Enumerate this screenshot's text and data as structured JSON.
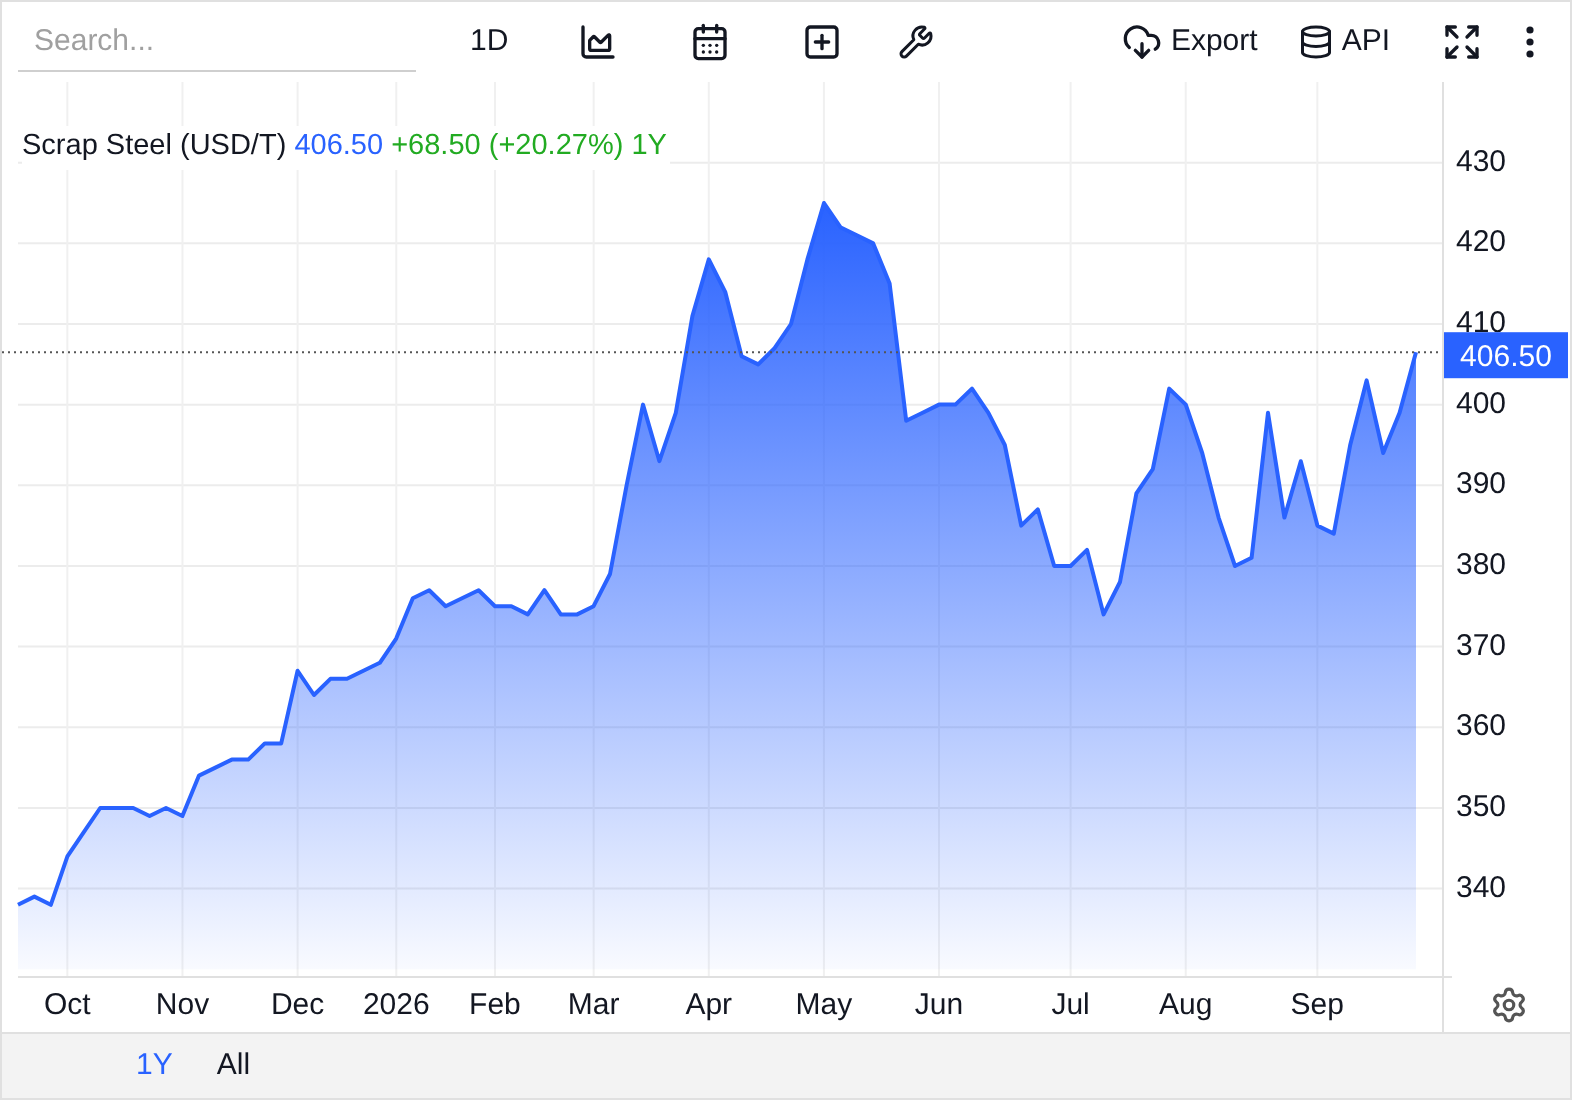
{
  "toolbar": {
    "search": {
      "placeholder": "Search..."
    },
    "interval": "1D",
    "export": "Export",
    "api": "API"
  },
  "legend": {
    "name": "Scrap Steel (USD/T)",
    "price": "406.50",
    "change": "+68.50 (+20.27%) 1Y"
  },
  "chart_data": {
    "type": "area",
    "grid": true,
    "ref_lines": [
      {
        "axis": "y",
        "value": 406.5,
        "label": "406.50"
      }
    ],
    "categories": [
      null,
      null,
      null,
      "Oct",
      null,
      null,
      null,
      null,
      null,
      null,
      "Nov",
      null,
      null,
      null,
      null,
      null,
      null,
      "Dec",
      null,
      null,
      null,
      null,
      null,
      "2026",
      null,
      null,
      null,
      null,
      null,
      "Feb",
      null,
      null,
      null,
      null,
      null,
      "Mar",
      null,
      null,
      null,
      null,
      null,
      null,
      "Apr",
      null,
      null,
      null,
      null,
      null,
      null,
      "May",
      null,
      null,
      null,
      null,
      null,
      null,
      "Jun",
      null,
      null,
      null,
      null,
      null,
      null,
      null,
      "Jul",
      null,
      null,
      null,
      null,
      null,
      null,
      "Aug",
      null,
      null,
      null,
      null,
      null,
      null,
      null,
      "Sep",
      null,
      null,
      null,
      null,
      null,
      null
    ],
    "series": [
      {
        "color": "#2962ff",
        "values": [
          338,
          339,
          338,
          344,
          347,
          350,
          350,
          350,
          349,
          350,
          349,
          354,
          355,
          356,
          356,
          358,
          358,
          367,
          364,
          366,
          366,
          367,
          368,
          371,
          376,
          377,
          375,
          376,
          377,
          375,
          375,
          374,
          377,
          374,
          374,
          375,
          379,
          390,
          400,
          393,
          399,
          411,
          418,
          414,
          406,
          405,
          407,
          410,
          418,
          425,
          422,
          421,
          420,
          415,
          398,
          399,
          400,
          400,
          402,
          399,
          395,
          385,
          387,
          380,
          380,
          382,
          374,
          378,
          389,
          392,
          402,
          400,
          394,
          386,
          380,
          381,
          399,
          386,
          393,
          385,
          384,
          395,
          403,
          394,
          399,
          406.5
        ]
      }
    ],
    "ylim": [
      322.2,
      440
    ],
    "yticks": [
      340,
      350,
      360,
      370,
      380,
      390,
      400,
      410,
      420,
      430
    ]
  },
  "range_tabs": [
    {
      "label": "1Y",
      "selected": true
    },
    {
      "label": "All",
      "selected": false
    }
  ]
}
